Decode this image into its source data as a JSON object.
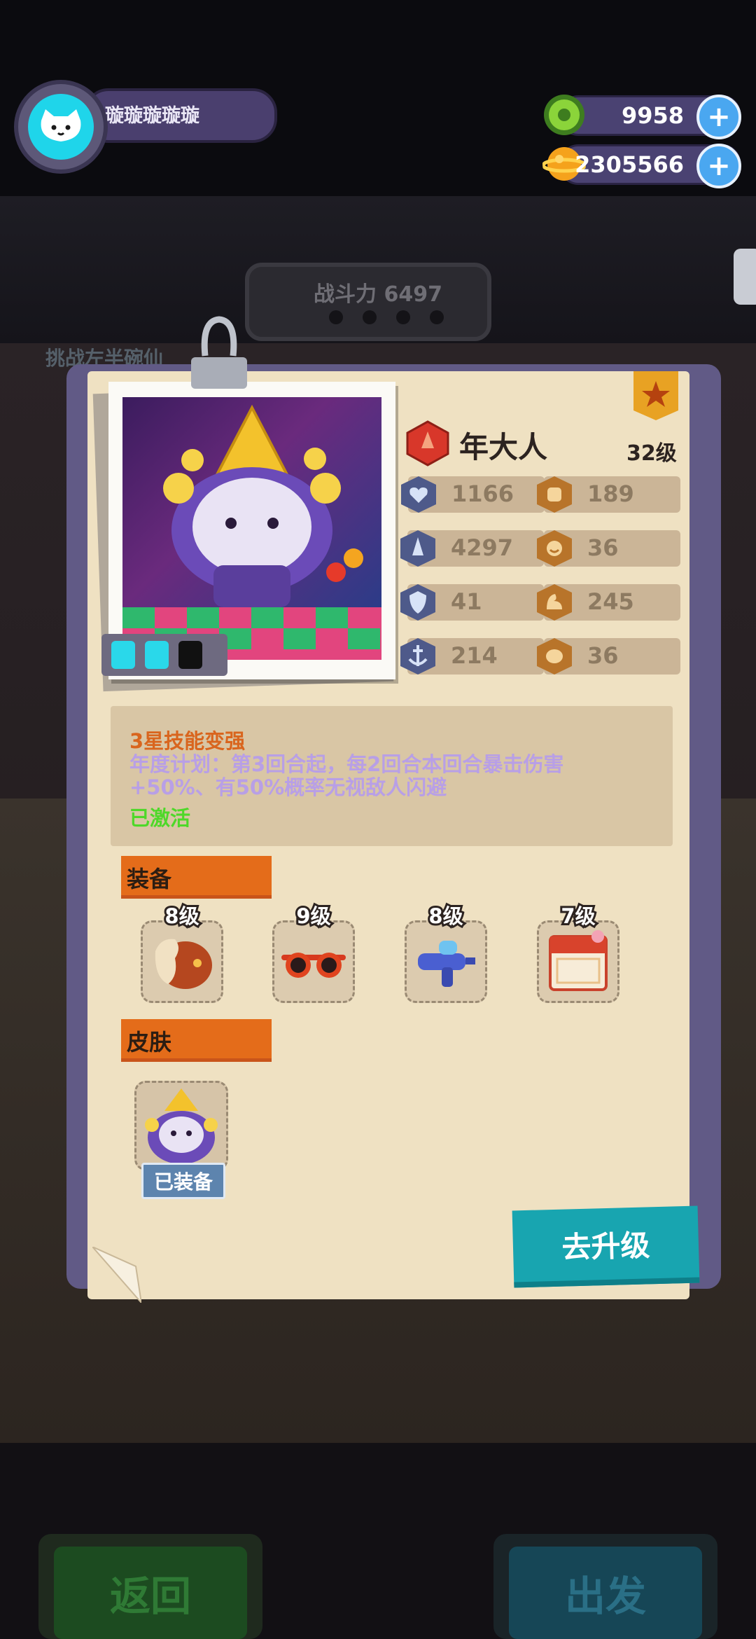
{
  "player": {
    "name": "璇璇璇璇璇"
  },
  "currencies": [
    {
      "icon": "green-donut-icon",
      "value": "9958"
    },
    {
      "icon": "gold-planet-icon",
      "value": "2305566"
    }
  ],
  "background": {
    "power_label": "战斗力 6497",
    "challenge_text": "挑战左半碗仙",
    "back_button": "返回",
    "go_button": "出发"
  },
  "hero": {
    "name": "年大人",
    "level": "32级",
    "stats": {
      "hp": "1166",
      "attack": "4297",
      "defense": "41",
      "speed": "214",
      "stat_5": "189",
      "stat_6": "36",
      "stat_7": "245",
      "stat_8": "36"
    }
  },
  "skill": {
    "title": "3星技能变强",
    "description": "年度计划：第3回合起，每2回合本回合暴击伤害 +50%、有50%概率无视敌人闪避",
    "status": "已激活"
  },
  "equipment": {
    "label": "装备",
    "items": [
      {
        "level": "8级",
        "icon": "fur-hat-icon"
      },
      {
        "level": "9级",
        "icon": "red-sunglasses-icon"
      },
      {
        "level": "8级",
        "icon": "water-gun-icon"
      },
      {
        "level": "7级",
        "icon": "calendar-icon"
      }
    ]
  },
  "skin": {
    "label": "皮肤",
    "equipped_label": "已装备"
  },
  "upgrade_button": "去升级",
  "colors": {
    "accent_orange": "#e46c1a",
    "upgrade_teal": "#18a5b0",
    "skill_purple": "#b89fe6",
    "active_green": "#4ed829"
  }
}
